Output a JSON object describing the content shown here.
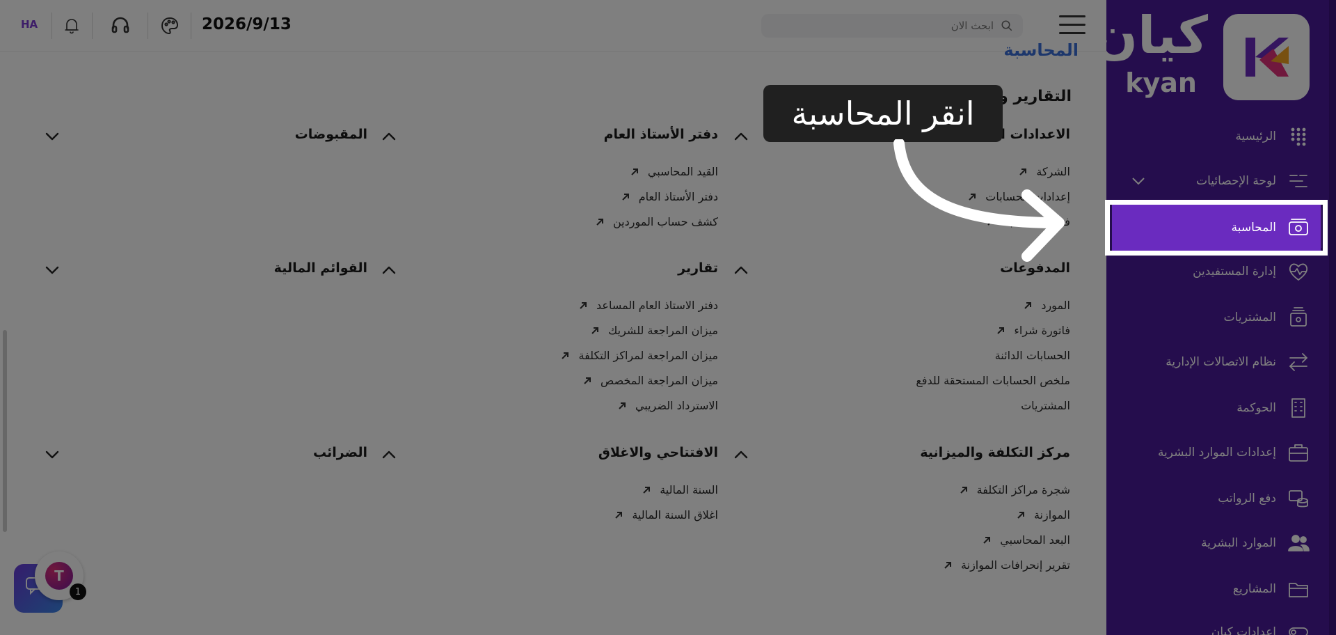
{
  "header": {
    "search_placeholder": "ابحث الان",
    "date": "2026/9/13",
    "user_initials": "HA"
  },
  "sidebar": {
    "logo_ar": "كيان",
    "logo_en": "kyan",
    "items": [
      {
        "label": "الرئيسية",
        "icon": "grid-dots-icon"
      },
      {
        "label": "لوحة الإحصائيات",
        "icon": "sliders-icon"
      },
      {
        "label": "المحاسبة",
        "icon": "money-icon"
      },
      {
        "label": "إدارة المستفيدين",
        "icon": "heart-pulse-icon"
      },
      {
        "label": "المشتريات",
        "icon": "box-icon"
      },
      {
        "label": "نظام الاتصالات الإدارية",
        "icon": "arrows-exchange-icon"
      },
      {
        "label": "الحوكمة",
        "icon": "building-icon"
      },
      {
        "label": "إعدادات الموارد البشرية",
        "icon": "briefcase-icon"
      },
      {
        "label": "دفع الرواتب",
        "icon": "coins-icon"
      },
      {
        "label": "الموارد البشرية",
        "icon": "users-icon"
      },
      {
        "label": "المشاريع",
        "icon": "folder-icon"
      },
      {
        "label": "إعدادات كيان",
        "icon": "toggle-icon"
      }
    ]
  },
  "main": {
    "page_title_partial": "المحاسبة",
    "section_title": "التقارير والبيانات الأساسية",
    "cards": [
      {
        "title": "الاعدادات الاساسية",
        "expanded": true,
        "links": [
          {
            "label": "الشركة",
            "external": true
          },
          {
            "label": "إعدادات الحسابات",
            "external": true
          },
          {
            "label": "فترة المحاسبة",
            "external": true
          }
        ]
      },
      {
        "title": "دفتر الأستاذ العام",
        "expanded": true,
        "links": [
          {
            "label": "القيد المحاسبي",
            "external": true
          },
          {
            "label": "دفتر الأستاذ العام",
            "external": true
          },
          {
            "label": "كشف حساب الموردين",
            "external": true
          }
        ]
      },
      {
        "title": "المقبوضات",
        "expanded": false,
        "links": []
      },
      {
        "title": "المدفوعات",
        "expanded": true,
        "links": [
          {
            "label": "المورد",
            "external": true
          },
          {
            "label": "فاتورة شراء",
            "external": true
          },
          {
            "label": "الحسابات الدائنة",
            "external": false
          },
          {
            "label": "ملخص الحسابات المستحقة للدفع",
            "external": false
          },
          {
            "label": "المشتريات",
            "external": false
          }
        ]
      },
      {
        "title": "تقارير",
        "expanded": true,
        "links": [
          {
            "label": "دفتر الاستاذ العام المساعد",
            "external": true
          },
          {
            "label": "ميزان المراجعة للشريك",
            "external": true
          },
          {
            "label": "ميزان المراجعة لمراكز التكلفة",
            "external": true
          },
          {
            "label": "ميزان المراجعة المخصص",
            "external": true
          },
          {
            "label": "الاسترداد الضريبي",
            "external": true
          }
        ]
      },
      {
        "title": "القوائم المالية",
        "expanded": false,
        "links": []
      },
      {
        "title": "مركز التكلفة والميزانية",
        "expanded": true,
        "links": [
          {
            "label": "شجرة مراكز التكلفة",
            "external": true
          },
          {
            "label": "الموازنة",
            "external": true
          },
          {
            "label": "البعد المحاسبي",
            "external": true
          },
          {
            "label": "تقرير إنحرافات الموازنة",
            "external": true
          }
        ]
      },
      {
        "title": "الافتتاحي والاغلاق",
        "expanded": true,
        "links": [
          {
            "label": "السنة المالية",
            "external": true
          },
          {
            "label": "اغلاق السنة المالية",
            "external": true
          }
        ]
      },
      {
        "title": "الضرائب",
        "expanded": false,
        "links": []
      }
    ]
  },
  "tooltip": {
    "text": "انقر المحاسبة"
  },
  "chat": {
    "badge_count": "1",
    "avatar_glyph": "T"
  },
  "colors": {
    "sidebar": "#4a1a9a",
    "active": "#6a2bbf",
    "accent": "#7a3bd0"
  }
}
